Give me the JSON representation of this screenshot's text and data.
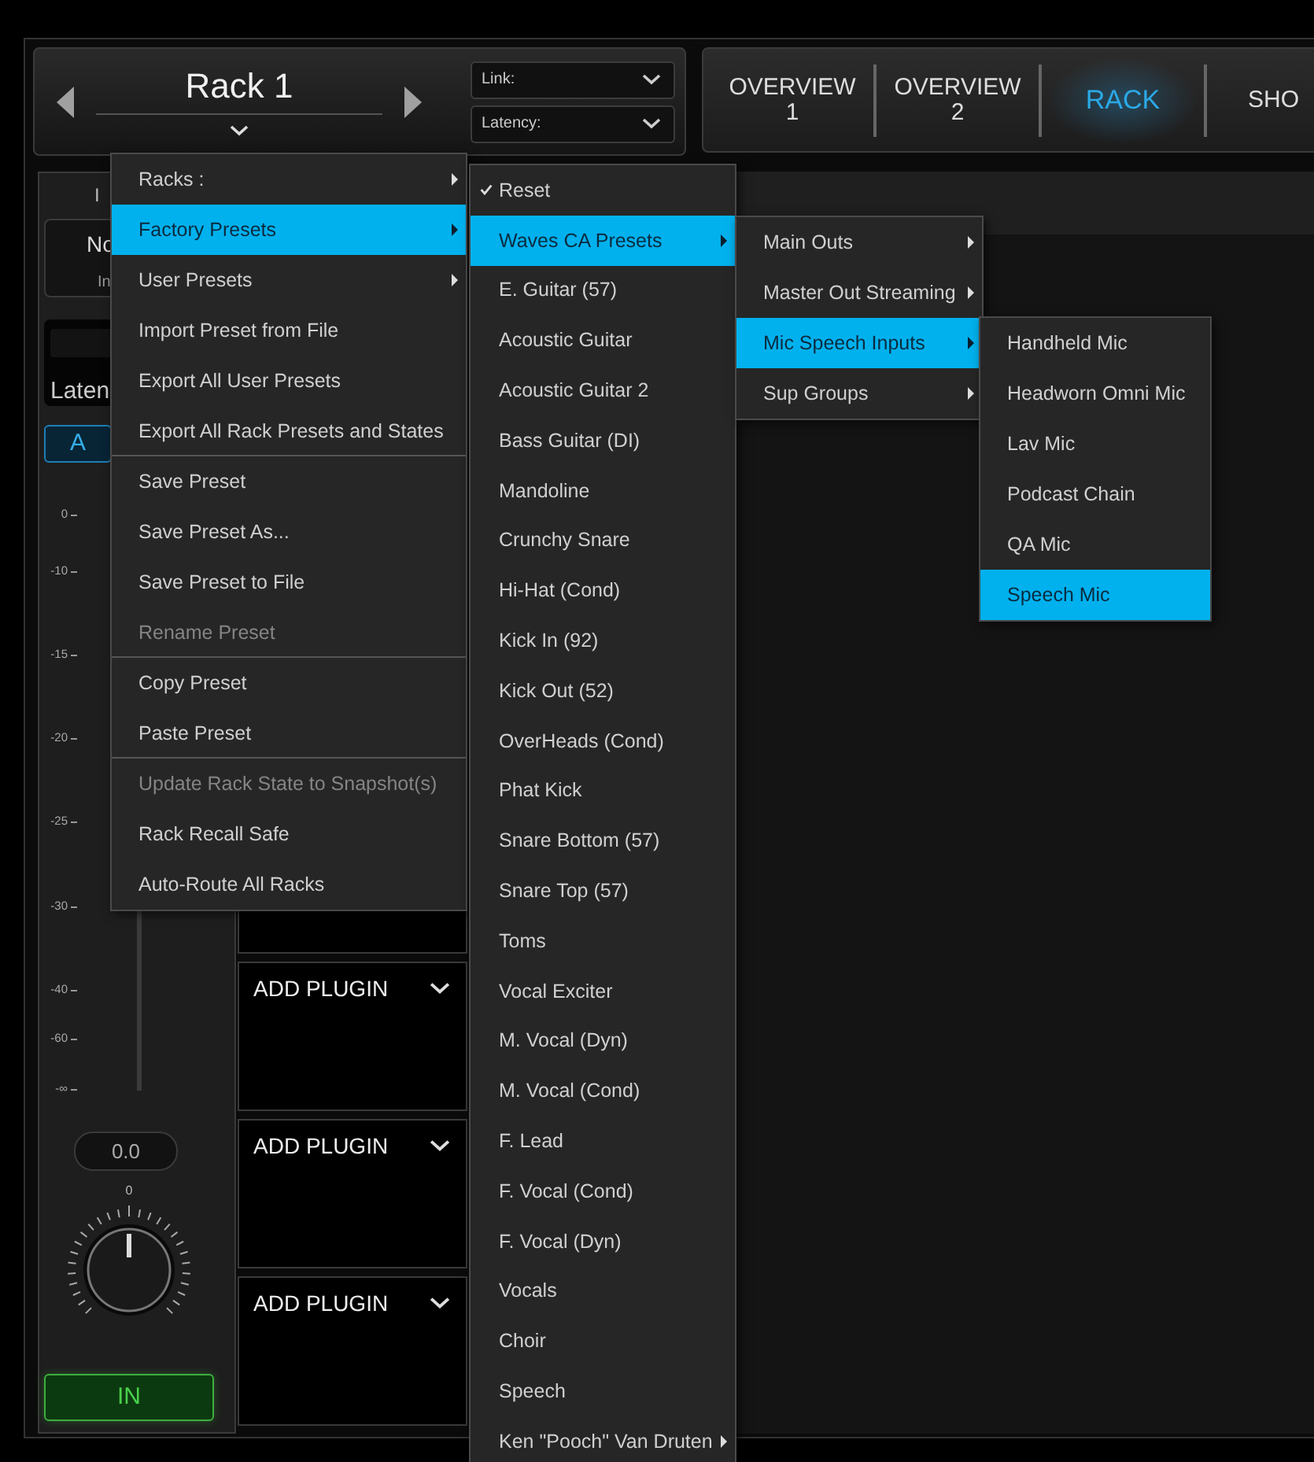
{
  "rack_selector": {
    "title": "Rack 1",
    "link_label": "Link:",
    "latency_label": "Latency:"
  },
  "tabs": [
    {
      "label": "OVERVIEW",
      "sub": "1",
      "selected": false
    },
    {
      "label": "OVERVIEW",
      "sub": "2",
      "selected": false
    },
    {
      "label": "RACK",
      "selected": true
    },
    {
      "label": "SHO",
      "selected": false
    }
  ],
  "channel": {
    "title": "I",
    "name_field": "No",
    "input_field": "In",
    "latency": "Laten",
    "ab_button": "A",
    "meter_scale": [
      "0",
      "-10",
      "-15",
      "-20",
      "-25",
      "-30",
      "-40",
      "-60",
      "-∞"
    ],
    "gain_value": "0.0",
    "knob_label": "0",
    "in_button": {
      "label": "IN",
      "on": true
    }
  },
  "plugin_slots": [
    {
      "label": "ADD PLUGIN"
    },
    {
      "label": "ADD PLUGIN"
    },
    {
      "label": "ADD PLUGIN"
    }
  ],
  "menus": [
    {
      "items": [
        {
          "label": "Racks :",
          "submenu": true,
          "selected": false,
          "disabled": false,
          "divider_after": false
        },
        {
          "label": "Factory Presets",
          "submenu": true,
          "selected": true,
          "disabled": false,
          "divider_after": false
        },
        {
          "label": "User Presets",
          "submenu": true,
          "selected": false,
          "disabled": false,
          "divider_after": false
        },
        {
          "label": "Import Preset from File",
          "submenu": false,
          "selected": false,
          "disabled": false,
          "divider_after": false
        },
        {
          "label": "Export All User Presets",
          "submenu": false,
          "selected": false,
          "disabled": false,
          "divider_after": false
        },
        {
          "label": "Export All Rack Presets and States",
          "submenu": false,
          "selected": false,
          "disabled": false,
          "divider_after": true
        },
        {
          "label": "Save Preset",
          "submenu": false,
          "selected": false,
          "disabled": false,
          "divider_after": false
        },
        {
          "label": "Save Preset As...",
          "submenu": false,
          "selected": false,
          "disabled": false,
          "divider_after": false
        },
        {
          "label": "Save Preset to File",
          "submenu": false,
          "selected": false,
          "disabled": false,
          "divider_after": false
        },
        {
          "label": "Rename Preset",
          "submenu": false,
          "selected": false,
          "disabled": true,
          "divider_after": true
        },
        {
          "label": "Copy Preset",
          "submenu": false,
          "selected": false,
          "disabled": false,
          "divider_after": false
        },
        {
          "label": "Paste Preset",
          "submenu": false,
          "selected": false,
          "disabled": false,
          "divider_after": true
        },
        {
          "label": "Update Rack State to Snapshot(s)",
          "submenu": false,
          "selected": false,
          "disabled": true,
          "divider_after": false
        },
        {
          "label": "Rack Recall Safe",
          "submenu": false,
          "selected": false,
          "disabled": false,
          "divider_after": false
        },
        {
          "label": "Auto-Route All Racks",
          "submenu": false,
          "selected": false,
          "disabled": false,
          "divider_after": false
        }
      ]
    },
    {
      "items": [
        {
          "label": "Reset",
          "submenu": false,
          "selected": false,
          "checked": true
        },
        {
          "label": "Waves CA Presets",
          "submenu": true,
          "selected": true,
          "checked": false
        },
        {
          "label": "E. Guitar (57)",
          "submenu": false,
          "selected": false,
          "checked": false
        },
        {
          "label": "Acoustic Guitar",
          "submenu": false,
          "selected": false,
          "checked": false
        },
        {
          "label": "Acoustic Guitar 2",
          "submenu": false,
          "selected": false,
          "checked": false
        },
        {
          "label": "Bass Guitar (DI)",
          "submenu": false,
          "selected": false,
          "checked": false
        },
        {
          "label": "Mandoline",
          "submenu": false,
          "selected": false,
          "checked": false
        },
        {
          "label": "Crunchy Snare",
          "submenu": false,
          "selected": false,
          "checked": false
        },
        {
          "label": "Hi-Hat (Cond)",
          "submenu": false,
          "selected": false,
          "checked": false
        },
        {
          "label": "Kick In (92)",
          "submenu": false,
          "selected": false,
          "checked": false
        },
        {
          "label": "Kick Out (52)",
          "submenu": false,
          "selected": false,
          "checked": false
        },
        {
          "label": "OverHeads (Cond)",
          "submenu": false,
          "selected": false,
          "checked": false
        },
        {
          "label": "Phat Kick",
          "submenu": false,
          "selected": false,
          "checked": false
        },
        {
          "label": "Snare Bottom (57)",
          "submenu": false,
          "selected": false,
          "checked": false
        },
        {
          "label": "Snare Top (57)",
          "submenu": false,
          "selected": false,
          "checked": false
        },
        {
          "label": "Toms",
          "submenu": false,
          "selected": false,
          "checked": false
        },
        {
          "label": "Vocal Exciter",
          "submenu": false,
          "selected": false,
          "checked": false
        },
        {
          "label": "M. Vocal (Dyn)",
          "submenu": false,
          "selected": false,
          "checked": false
        },
        {
          "label": "M. Vocal (Cond)",
          "submenu": false,
          "selected": false,
          "checked": false
        },
        {
          "label": "F. Lead",
          "submenu": false,
          "selected": false,
          "checked": false
        },
        {
          "label": "F. Vocal (Cond)",
          "submenu": false,
          "selected": false,
          "checked": false
        },
        {
          "label": "F. Vocal (Dyn)",
          "submenu": false,
          "selected": false,
          "checked": false
        },
        {
          "label": "Vocals",
          "submenu": false,
          "selected": false,
          "checked": false
        },
        {
          "label": "Choir",
          "submenu": false,
          "selected": false,
          "checked": false
        },
        {
          "label": "Speech",
          "submenu": false,
          "selected": false,
          "checked": false
        },
        {
          "label": "Ken \"Pooch\" Van Druten",
          "submenu": true,
          "selected": false,
          "checked": false
        }
      ]
    },
    {
      "items": [
        {
          "label": "Main Outs",
          "submenu": true,
          "selected": false
        },
        {
          "label": "Master Out Streaming",
          "submenu": true,
          "selected": false
        },
        {
          "label": "Mic Speech Inputs",
          "submenu": true,
          "selected": true
        },
        {
          "label": "Sup Groups",
          "submenu": true,
          "selected": false
        }
      ]
    },
    {
      "items": [
        {
          "label": "Handheld Mic",
          "submenu": false,
          "selected": false
        },
        {
          "label": "Headworn Omni Mic",
          "submenu": false,
          "selected": false
        },
        {
          "label": "Lav Mic",
          "submenu": false,
          "selected": false
        },
        {
          "label": "Podcast Chain",
          "submenu": false,
          "selected": false
        },
        {
          "label": "QA Mic",
          "submenu": false,
          "selected": false
        },
        {
          "label": "Speech Mic",
          "submenu": false,
          "selected": true
        }
      ]
    }
  ]
}
